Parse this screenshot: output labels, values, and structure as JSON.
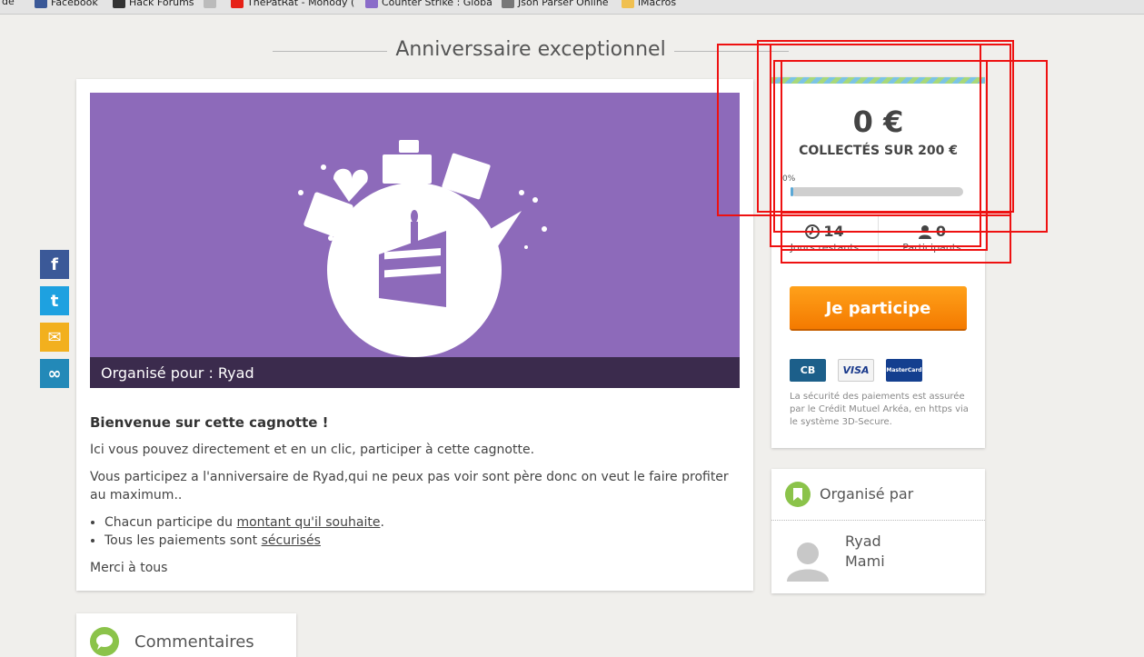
{
  "bookmarks": [
    {
      "label": "r de",
      "icon": "folder-icon"
    },
    {
      "label": "Facebook",
      "icon": "facebook-icon"
    },
    {
      "label": "Hack Forums",
      "icon": "hackforums-icon"
    },
    {
      "label": "",
      "icon": "page-icon"
    },
    {
      "label": "ThePatRat - Monody (",
      "icon": "youtube-icon"
    },
    {
      "label": "Counter Strike : Globa",
      "icon": "csgo-icon"
    },
    {
      "label": "Json Parser Online",
      "icon": "json-icon"
    },
    {
      "label": "iMacros",
      "icon": "folder-icon"
    }
  ],
  "page": {
    "title": "Anniverssaire exceptionnel"
  },
  "social": {
    "facebook": "f",
    "twitter": "t",
    "email": "✉",
    "link": "∞"
  },
  "banner": {
    "organised_for": "Organisé pour : Ryad"
  },
  "description": {
    "heading": "Bienvenue sur cette cagnotte !",
    "para1": "Ici vous pouvez directement et en un clic, participer à cette cagnotte.",
    "para2": "Vous participez a l'anniversaire de Ryad,qui ne peux pas voir sont père donc on veut le faire profiter au maximum..",
    "bullet1_prefix": "Chacun participe du ",
    "bullet1_link": "montant qu'il souhaite",
    "bullet1_suffix": ".",
    "bullet2_prefix": "Tous les paiements sont ",
    "bullet2_link": "sécurisés",
    "closing": "Merci à tous"
  },
  "stats": {
    "amount": "0 €",
    "collected_label": "COLLECTÉS SUR 200 €",
    "percent_label": "0%",
    "progress": 0.0,
    "days_remaining": "14",
    "days_label": "Jours restants",
    "participants": "0",
    "participants_label": "Participants"
  },
  "cta": {
    "label": "Je participe"
  },
  "payments": {
    "cb": "CB",
    "visa": "VISA",
    "mastercard": "MasterCard",
    "security_text": "La sécurité des paiements est assurée par le Crédit Mutuel Arkéa, en https via le système 3D-Secure."
  },
  "organiser": {
    "heading": "Organisé par",
    "first_name": "Ryad",
    "last_name": "Mami"
  },
  "comments": {
    "heading": "Commentaires"
  },
  "colors": {
    "banner": "#8d6aba",
    "banner_bar": "#3b2b4d",
    "cta": "#f7890c",
    "accent_green": "#8bc34a",
    "annotation_red": "#ee1111"
  }
}
